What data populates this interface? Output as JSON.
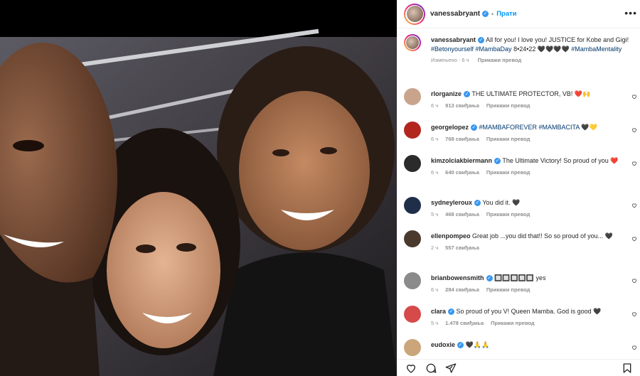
{
  "post": {
    "author": "vanessabryant",
    "follow_label": "Прати",
    "more_icon": "more-horizontal-icon"
  },
  "caption": {
    "username": "vanessabryant",
    "text_part1": "All for you! I love you! JUSTICE for Kobe and Gigi! ",
    "hashtags": "#Betonyourself #MambaDay",
    "text_part2": " 8•24•22 🖤🖤🖤🖤",
    "hashtag2": "#MambaMentality",
    "edited": "Измењено · 6 ч",
    "translate": "Прикажи превод"
  },
  "comments": [
    {
      "user": "rlorganize",
      "verified": true,
      "text": "THE ULTIMATE PROTECTOR, VB! ❤️🙌",
      "time": "6 ч",
      "likes": "913 свиђања",
      "translate": "Прикажи превод",
      "avatar_color": "#c9a48d"
    },
    {
      "user": "georgelopez",
      "verified": true,
      "text": "#MAMBAFOREVER #MAMBACITA 🖤💛",
      "time": "6 ч",
      "likes": "768 свиђања",
      "translate": "Прикажи превод",
      "avatar_color": "#b3261e"
    },
    {
      "user": "kimzolciakbiermann",
      "verified": true,
      "text": "The Ultimate Victory! So proud of you ❤️",
      "time": "6 ч",
      "likes": "640 свиђања",
      "translate": "Прикажи превод",
      "avatar_color": "#2b2b2b"
    },
    {
      "user": "sydneyleroux",
      "verified": true,
      "text": "You did it. 🖤",
      "time": "5 ч",
      "likes": "468 свиђања",
      "translate": "Прикажи превод",
      "avatar_color": "#1f2f4a"
    },
    {
      "user": "ellenpompeo",
      "verified": false,
      "text": "Great job ...you did that!! So so proud of you... 🖤",
      "time": "2 ч",
      "likes": "557 свиђања",
      "translate": "",
      "avatar_color": "#4a3a2e"
    },
    {
      "user": "brianbowensmith",
      "verified": true,
      "text": "🔲🔲🔲🔲🔲 yes",
      "time": "6 ч",
      "likes": "284 свиђања",
      "translate": "Прикажи превод",
      "avatar_color": "#8b8b8b"
    },
    {
      "user": "clara",
      "verified": true,
      "text": "So proud of you V! Queen Mamba. God is good 🖤",
      "time": "5 ч",
      "likes": "1.478 свиђања",
      "translate": "Прикажи превод",
      "avatar_color": "#d64a4a"
    },
    {
      "user": "eudoxie",
      "verified": true,
      "text": "🖤🙏🙏",
      "time": "",
      "likes": "",
      "translate": "",
      "avatar_color": "#caa67a"
    }
  ],
  "actions": {
    "like_icon": "heart-icon",
    "comment_icon": "comment-icon",
    "share_icon": "send-icon",
    "save_icon": "bookmark-icon"
  },
  "colors": {
    "accent": "#0095f6",
    "verified": "#3897f0",
    "text": "#262626",
    "muted": "#8e8e8e"
  }
}
